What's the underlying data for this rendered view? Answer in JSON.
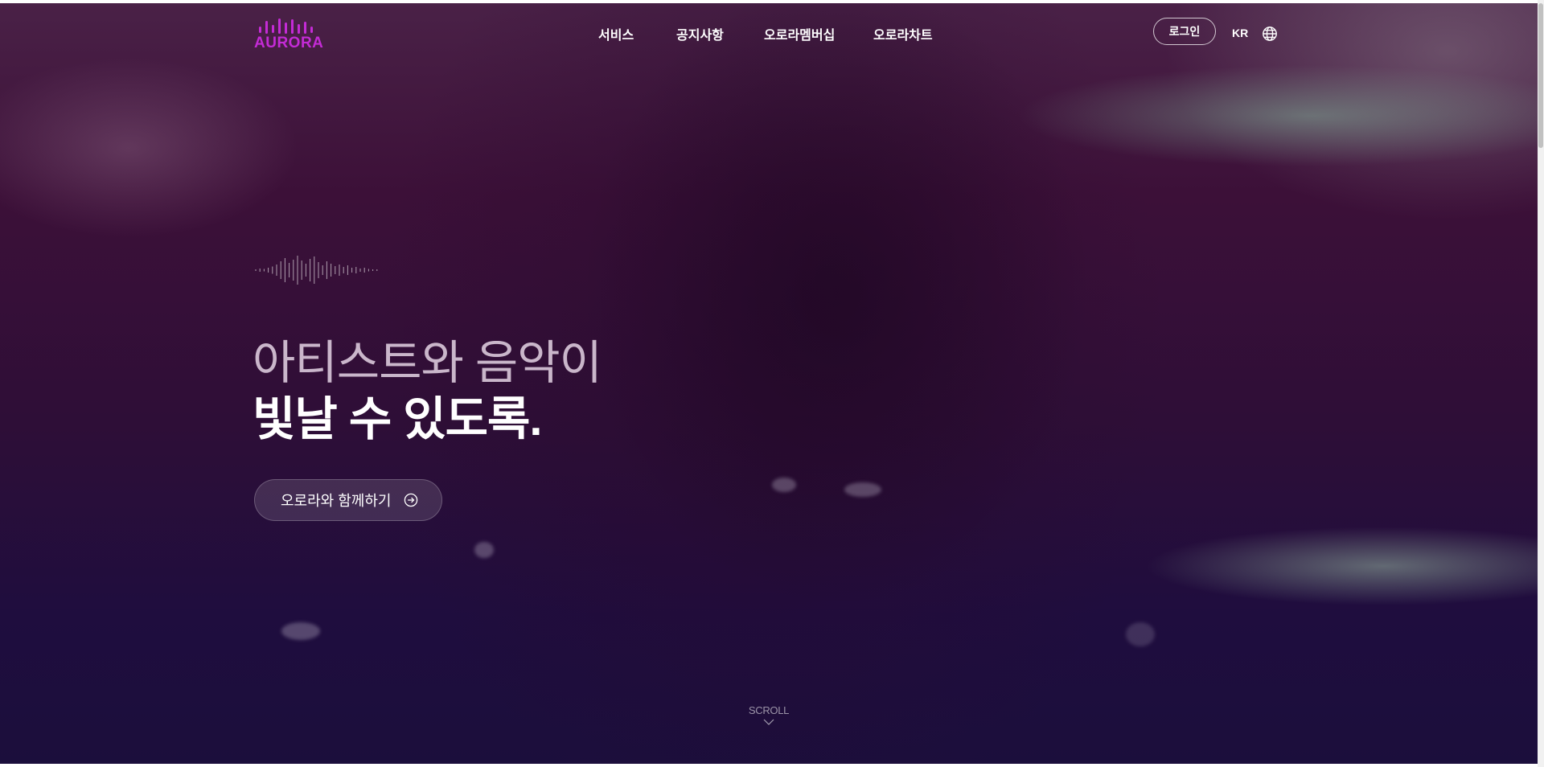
{
  "brand": {
    "name": "AURORA",
    "accent_color": "#c42bd6"
  },
  "nav": {
    "items": [
      {
        "label": "서비스"
      },
      {
        "label": "공지사항"
      },
      {
        "label": "오로라멤버십"
      },
      {
        "label": "오로라차트"
      }
    ]
  },
  "header": {
    "login_label": "로그인",
    "language": "KR",
    "globe_icon": "globe-icon"
  },
  "hero": {
    "headline_line1": "아티스트와 음악이",
    "headline_line2": "빛날 수 있도록.",
    "cta_label": "오로라와 함께하기",
    "cta_icon": "arrow-right-circle-icon",
    "scroll_label": "SCROLL",
    "scroll_icon": "chevron-down-icon"
  }
}
